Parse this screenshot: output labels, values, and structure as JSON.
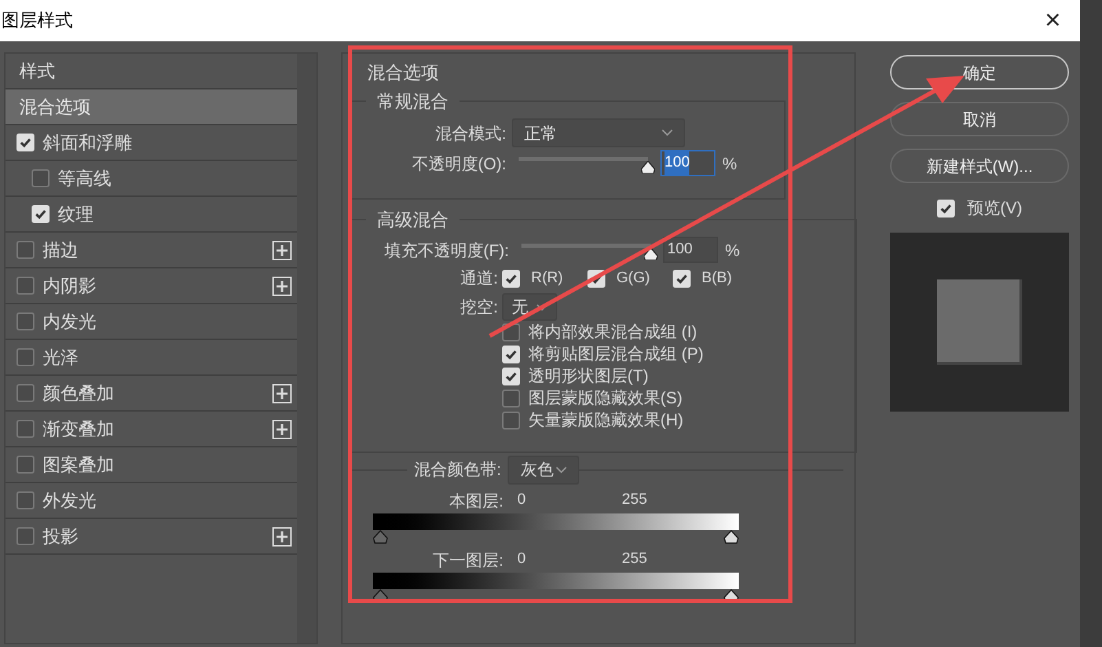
{
  "window": {
    "title": "图层样式",
    "close": "×"
  },
  "styles_list": {
    "items": [
      {
        "kind": "header",
        "label": "样式",
        "selected": false
      },
      {
        "kind": "plain",
        "label": "混合选项",
        "selected": true
      },
      {
        "kind": "check",
        "label": "斜面和浮雕",
        "checked": true,
        "plus": false,
        "selected": false,
        "children": [
          {
            "kind": "check",
            "label": "等高线",
            "checked": false,
            "plus": false,
            "selected": false
          },
          {
            "kind": "check",
            "label": "纹理",
            "checked": true,
            "plus": false,
            "selected": false
          }
        ]
      },
      {
        "kind": "check",
        "label": "描边",
        "checked": false,
        "plus": true,
        "selected": false
      },
      {
        "kind": "check",
        "label": "内阴影",
        "checked": false,
        "plus": true,
        "selected": false
      },
      {
        "kind": "check",
        "label": "内发光",
        "checked": false,
        "plus": false,
        "selected": false
      },
      {
        "kind": "check",
        "label": "光泽",
        "checked": false,
        "plus": false,
        "selected": false
      },
      {
        "kind": "check",
        "label": "颜色叠加",
        "checked": false,
        "plus": true,
        "selected": false
      },
      {
        "kind": "check",
        "label": "渐变叠加",
        "checked": false,
        "plus": true,
        "selected": false
      },
      {
        "kind": "check",
        "label": "图案叠加",
        "checked": false,
        "plus": false,
        "selected": false
      },
      {
        "kind": "check",
        "label": "外发光",
        "checked": false,
        "plus": false,
        "selected": false
      },
      {
        "kind": "check",
        "label": "投影",
        "checked": false,
        "plus": true,
        "selected": false
      }
    ]
  },
  "blending_options": {
    "title": "混合选项",
    "general": {
      "title": "常规混合",
      "blend_mode": {
        "label": "混合模式:",
        "value": "正常"
      },
      "opacity": {
        "label": "不透明度(O):",
        "level": 1.0,
        "value": "100",
        "unit": "%"
      }
    },
    "advanced": {
      "title": "高级混合",
      "fill_opacity": {
        "label": "填充不透明度(F):",
        "level": 1.0,
        "value": "100",
        "unit": "%"
      },
      "channels": {
        "label": "通道:",
        "items": [
          {
            "label": "R(R)",
            "checked": true
          },
          {
            "label": "G(G)",
            "checked": true
          },
          {
            "label": "B(B)",
            "checked": true
          }
        ]
      },
      "knockout": {
        "label": "挖空:",
        "value": "无"
      },
      "options": [
        {
          "label": "将内部效果混合成组 (I)",
          "checked": false
        },
        {
          "label": "将剪贴图层混合成组 (P)",
          "checked": true
        },
        {
          "label": "透明形状图层(T)",
          "checked": true
        },
        {
          "label": "图层蒙版隐藏效果(S)",
          "checked": false
        },
        {
          "label": "矢量蒙版隐藏效果(H)",
          "checked": false
        }
      ]
    },
    "blend_if": {
      "label": "混合颜色带:",
      "value": "灰色",
      "bands": [
        {
          "label": "本图层:",
          "low": "0",
          "high": "255"
        },
        {
          "label": "下一图层:",
          "low": "0",
          "high": "255"
        }
      ]
    }
  },
  "buttons": [
    {
      "label": "确定",
      "default": true
    },
    {
      "label": "取消",
      "default": false
    },
    {
      "label": "新建样式(W)...",
      "default": false
    }
  ],
  "preview": {
    "label": "预览(V)",
    "checked": true
  }
}
